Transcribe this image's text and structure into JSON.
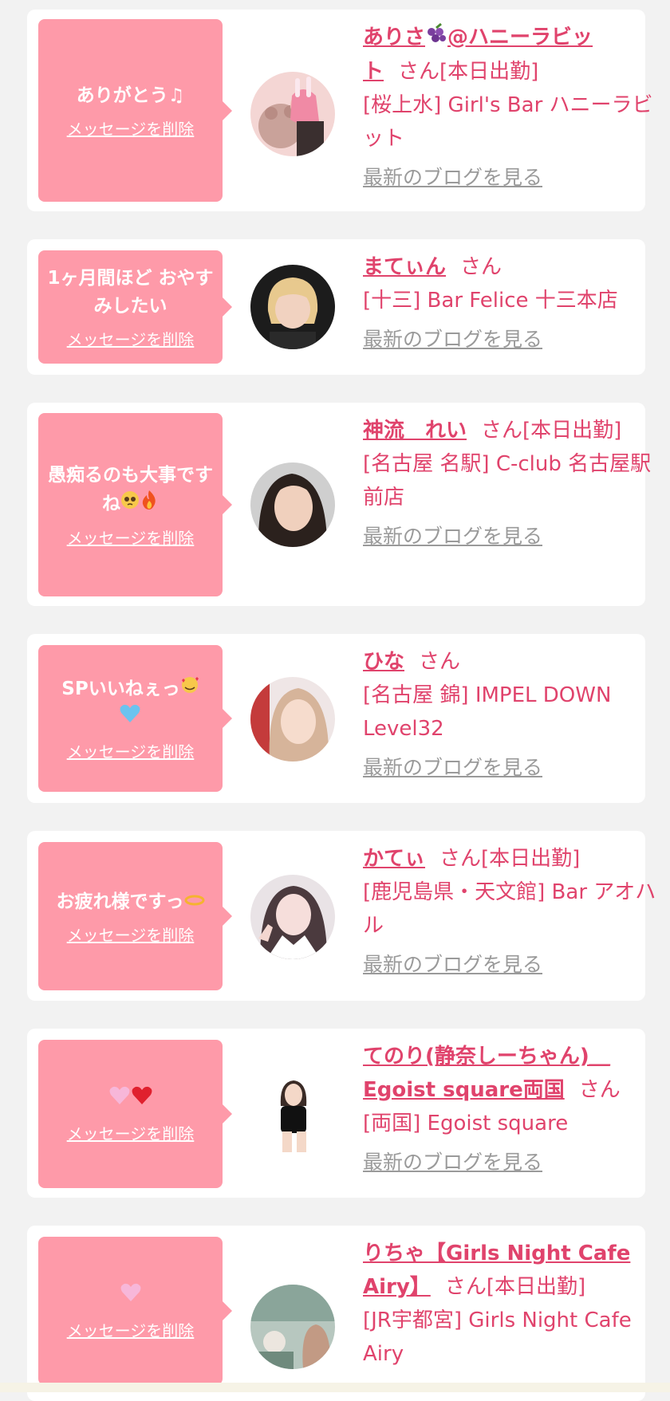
{
  "delete_label": "メッセージを削除",
  "blog_label": "最新のブログを見る",
  "san": "さん",
  "cards": [
    {
      "message": "ありがとう♫",
      "name_line1": "ありさ",
      "name_emoji": "grape-icon",
      "name_line1b": "@ハニーラビッ",
      "name_line2": "ト",
      "suffix": "さん[本日出勤]",
      "shop": "[桜上水] Girl's Bar ハニーラビット"
    },
    {
      "message": "1ヶ月間ほど おやすみしたい",
      "name": "まてぃん",
      "suffix": "さん",
      "shop": "[十三] Bar Felice 十三本店"
    },
    {
      "message": "愚痴るのも大事ですね",
      "message_emojis": [
        "pleading-face-icon",
        "fire-icon"
      ],
      "name": "神流　れい",
      "suffix": "さん[本日出勤]",
      "shop": "[名古屋 名駅] C-club 名古屋駅前店"
    },
    {
      "message": "SPいいねぇっ",
      "message_emojis": [
        "smiling-face-with-hearts-icon",
        "blue-heart-icon"
      ],
      "name": "ひな",
      "suffix": "さん",
      "shop": "[名古屋 錦] IMPEL DOWN Level32"
    },
    {
      "message": "お疲れ様ですっ",
      "message_emojis": [
        "halo-icon"
      ],
      "name": "かてぃ",
      "suffix": "さん[本日出勤]",
      "shop": "[鹿児島県・天文館] Bar アオハル"
    },
    {
      "message": "",
      "message_emojis": [
        "pink-heart-icon",
        "red-heart-icon"
      ],
      "name": "てのり(静奈しーちゃん)＿Egoist square両国",
      "suffix": "さん",
      "shop": "[両国] Egoist square"
    },
    {
      "message": "",
      "message_emojis": [
        "pink-heart-icon"
      ],
      "name": "りちゃ【Girls Night Cafe Airy】",
      "suffix": "さん[本日出勤]",
      "shop": "[JR宇都宮] Girls Night Cafe Airy"
    }
  ],
  "colors": {
    "bubble": "#fe9aa9",
    "name": "#e0436c",
    "blog": "#9a9a9a",
    "background": "#f2f2f2"
  }
}
